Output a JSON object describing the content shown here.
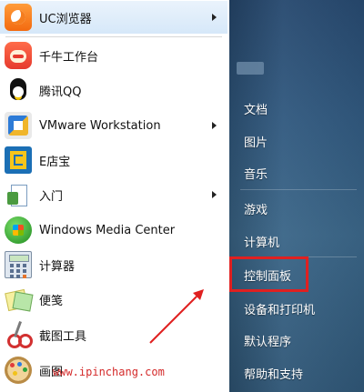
{
  "programs": [
    {
      "label": "UC浏览器",
      "icon": "uc-browser-icon",
      "has_submenu": true
    },
    {
      "label": "千牛工作台",
      "icon": "qianniu-icon",
      "has_submenu": false
    },
    {
      "label": "腾讯QQ",
      "icon": "qq-penguin-icon",
      "has_submenu": false
    },
    {
      "label": "VMware Workstation",
      "icon": "vmware-icon",
      "has_submenu": true
    },
    {
      "label": "E店宝",
      "icon": "edianbao-icon",
      "has_submenu": false
    },
    {
      "label": "入门",
      "icon": "getting-started-icon",
      "has_submenu": true
    },
    {
      "label": "Windows Media Center",
      "icon": "windows-media-center-icon",
      "has_submenu": false
    },
    {
      "label": "计算器",
      "icon": "calculator-icon",
      "has_submenu": false
    },
    {
      "label": "便笺",
      "icon": "sticky-notes-icon",
      "has_submenu": false
    },
    {
      "label": "截图工具",
      "icon": "snipping-tool-icon",
      "has_submenu": false
    },
    {
      "label": "画图",
      "icon": "paint-icon",
      "has_submenu": false
    }
  ],
  "watermark": "www.ipinchang.com",
  "right_panel": {
    "items": [
      {
        "label": "文档"
      },
      {
        "label": "图片"
      },
      {
        "label": "音乐"
      },
      {
        "label": "游戏"
      },
      {
        "label": "计算机"
      },
      {
        "label": "控制面板",
        "highlighted": true
      },
      {
        "label": "设备和打印机"
      },
      {
        "label": "默认程序"
      },
      {
        "label": "帮助和支持"
      }
    ]
  },
  "colors": {
    "annotation_red": "#e02020",
    "panel_blue": "#31597f"
  }
}
